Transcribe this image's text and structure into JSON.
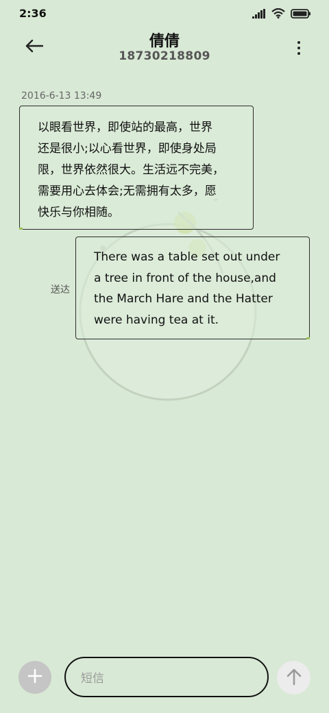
{
  "status_bar": {
    "time": "2:36",
    "icons": [
      "signal-icon",
      "wifi-icon",
      "battery-icon"
    ]
  },
  "header": {
    "back_icon": "arrow-left-icon",
    "contact_name": "倩倩",
    "contact_number": "18730218809",
    "more_icon": "more-vertical-icon"
  },
  "conversation": {
    "timestamp": "2016-6-13 13:49",
    "messages": [
      {
        "direction": "incoming",
        "lines": [
          "以眼看世界，即使站的最高，世界",
          "还是很小;以心看世界，即使身处局",
          "限，世界依然很大。生活远不完美，",
          "需要用心去体会;无需拥有太多，愿",
          "快乐与你相随。"
        ]
      },
      {
        "direction": "outgoing",
        "status": "送达",
        "lines": [
          "There was a table set out under",
          "a tree in front of the house,and",
          "the March Hare and the Hatter",
          "were having tea at it."
        ]
      }
    ]
  },
  "composer": {
    "add_icon": "plus-icon",
    "placeholder": "短信",
    "send_icon": "arrow-up-icon"
  },
  "colors": {
    "background": "#d8e9d5",
    "bubble_border": "#2d2d2d",
    "accent_tick": "#9fbf58",
    "add_button": "#c5c5c5",
    "send_button": "#ececec"
  }
}
